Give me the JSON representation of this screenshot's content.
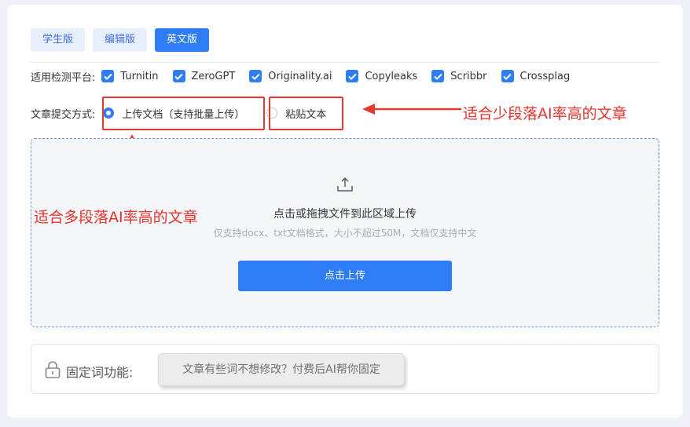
{
  "tabs": [
    {
      "label": "学生版",
      "active": false
    },
    {
      "label": "编辑版",
      "active": false
    },
    {
      "label": "英文版",
      "active": true
    }
  ],
  "platforms": {
    "label": "适用检测平台:",
    "items": [
      {
        "label": "Turnitin",
        "checked": true
      },
      {
        "label": "ZeroGPT",
        "checked": true
      },
      {
        "label": "Originality.ai",
        "checked": true
      },
      {
        "label": "Copyleaks",
        "checked": true
      },
      {
        "label": "Scribbr",
        "checked": true
      },
      {
        "label": "Crossplag",
        "checked": true
      }
    ]
  },
  "submit": {
    "label": "文章提交方式:",
    "options": [
      {
        "label": "上传文档（支持批量上传）",
        "selected": true
      },
      {
        "label": "粘贴文本",
        "selected": false
      }
    ]
  },
  "annotations": {
    "right": "适合少段落AI率高的文章",
    "left": "适合多段落AI率高的文章"
  },
  "dropzone": {
    "icon": "upload-icon",
    "title": "点击或拖拽文件到此区域上传",
    "subtitle": "仅支持docx、txt文档格式，大小不超过50M，文档仅支持中文",
    "button": "点击上传"
  },
  "fixed": {
    "icon": "lock-icon",
    "label": "固定词功能:",
    "button": "文章有些词不想修改？付费后AI帮你固定"
  },
  "colors": {
    "accent": "#2f7df6",
    "annotation": "#e8322a"
  }
}
